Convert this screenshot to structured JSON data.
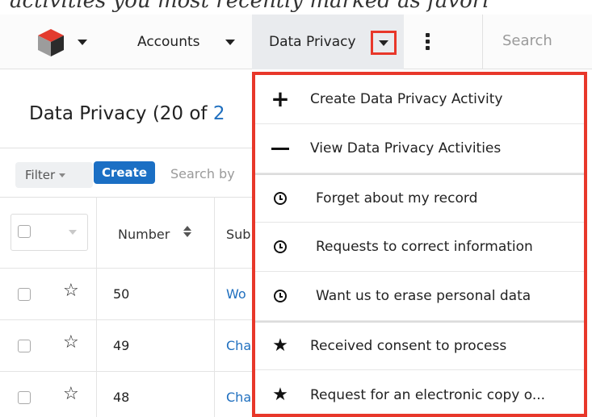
{
  "caption_text": "activities you most recently marked as favori",
  "nav": {
    "accounts_label": "Accounts",
    "data_privacy_label": "Data Privacy",
    "search_placeholder": "Search"
  },
  "page": {
    "title_prefix": "Data Privacy (20 of ",
    "title_link": "2"
  },
  "filter_bar": {
    "filter_label": "Filter",
    "create_label": "Create",
    "search_placeholder": "Search by"
  },
  "table": {
    "columns": [
      "Number",
      "Sub"
    ],
    "rows": [
      {
        "number": "50",
        "subject": "Wo"
      },
      {
        "number": "49",
        "subject": "Cha"
      },
      {
        "number": "48",
        "subject": "Cha"
      }
    ]
  },
  "menu": {
    "items": [
      {
        "label": "Create Data Privacy Activity",
        "icon": "plus-icon"
      },
      {
        "label": "View Data Privacy Activities",
        "icon": "list-icon"
      },
      {
        "label": "Forget about my record",
        "icon": "clock-icon"
      },
      {
        "label": "Requests to correct information",
        "icon": "clock-icon"
      },
      {
        "label": "Want us to erase personal data",
        "icon": "clock-icon"
      },
      {
        "label": "Received consent to process",
        "icon": "star-icon"
      },
      {
        "label": "Request for an electronic copy o...",
        "icon": "star-icon"
      }
    ]
  },
  "colors": {
    "highlight": "#e8372a",
    "link": "#1f6fbf",
    "create_button": "#1b6fc4"
  }
}
